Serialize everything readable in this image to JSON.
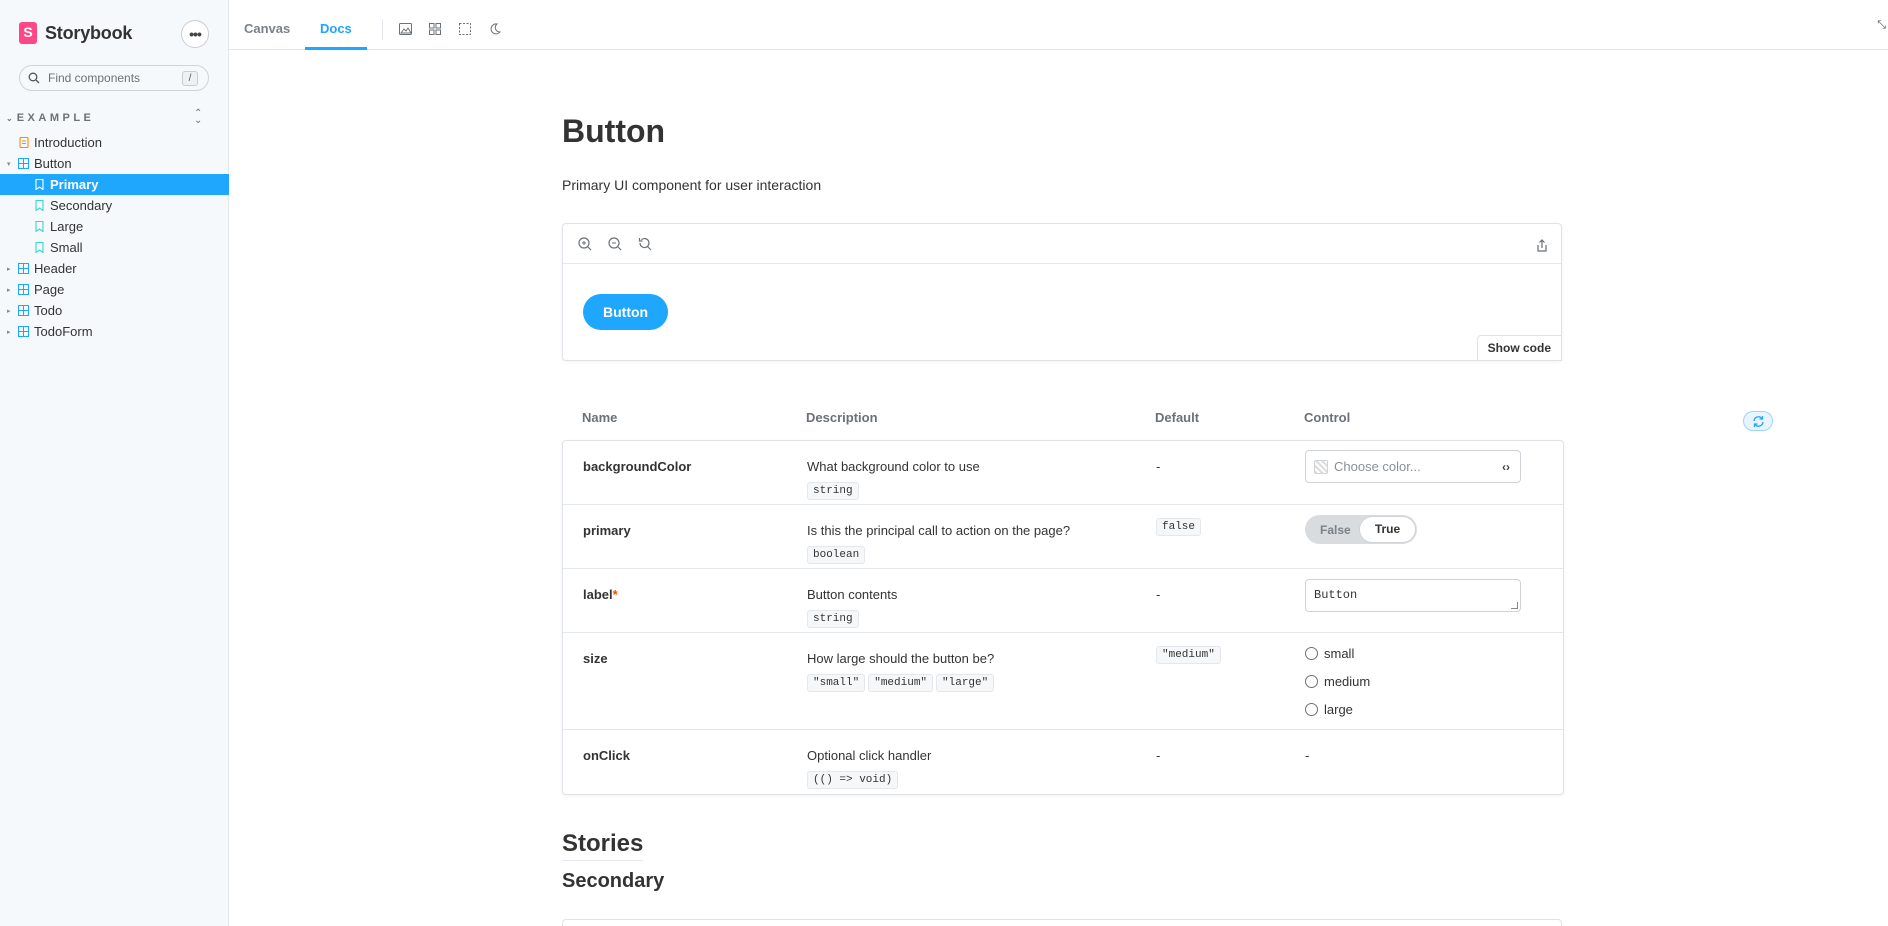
{
  "sidebar": {
    "brand": "Storybook",
    "search_placeholder": "Find components",
    "search_shortcut": "/",
    "section": "EXAMPLE",
    "items": [
      {
        "label": "Introduction",
        "type": "doc"
      },
      {
        "label": "Button",
        "type": "component",
        "expanded": true
      },
      {
        "label": "Primary",
        "type": "story",
        "selected": true
      },
      {
        "label": "Secondary",
        "type": "story"
      },
      {
        "label": "Large",
        "type": "story"
      },
      {
        "label": "Small",
        "type": "story"
      },
      {
        "label": "Header",
        "type": "component"
      },
      {
        "label": "Page",
        "type": "component"
      },
      {
        "label": "Todo",
        "type": "component"
      },
      {
        "label": "TodoForm",
        "type": "component"
      }
    ]
  },
  "toolbar": {
    "tabs": [
      {
        "label": "Canvas"
      },
      {
        "label": "Docs",
        "active": true
      }
    ]
  },
  "docs": {
    "title": "Button",
    "subtitle": "Primary UI component for user interaction",
    "demo_button": "Button",
    "show_code": "Show code",
    "headers": {
      "name": "Name",
      "description": "Description",
      "default": "Default",
      "control": "Control"
    },
    "rows": [
      {
        "name": "backgroundColor",
        "description": "What background color to use",
        "types": [
          "string"
        ],
        "default": "-",
        "control_placeholder": "Choose color..."
      },
      {
        "name": "primary",
        "description": "Is this the principal call to action on the page?",
        "types": [
          "boolean"
        ],
        "default": "false",
        "control_false": "False",
        "control_true": "True"
      },
      {
        "name": "label",
        "required_mark": "*",
        "description": "Button contents",
        "types": [
          "string"
        ],
        "default": "-",
        "control_value": "Button"
      },
      {
        "name": "size",
        "description": "How large should the button be?",
        "types": [
          "\"small\"",
          "\"medium\"",
          "\"large\""
        ],
        "default": "\"medium\"",
        "options": [
          "small",
          "medium",
          "large"
        ]
      },
      {
        "name": "onClick",
        "description": "Optional click handler",
        "types": [
          "(() => void)"
        ],
        "default": "-",
        "control_text": "-"
      }
    ],
    "stories_heading": "Stories",
    "secondary_heading": "Secondary"
  },
  "colors": {
    "accent": "#1ea7fd",
    "brand": "#ff4785",
    "required": "#ff4400"
  }
}
